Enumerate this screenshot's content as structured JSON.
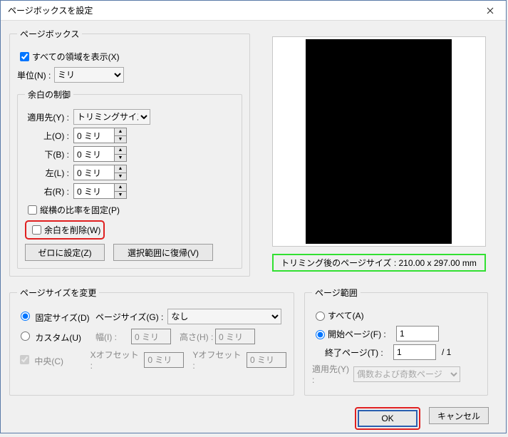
{
  "window": {
    "title": "ページボックスを設定"
  },
  "pageBox": {
    "legend": "ページボックス",
    "showAllAreas": "すべての領域を表示(X)",
    "unitLabel": "単位(N) :",
    "unitValue": "ミリ",
    "margin": {
      "legend": "余白の制御",
      "applyLabel": "適用先(Y) :",
      "applyValue": "トリミングサイズ",
      "topLabel": "上(O) :",
      "topValue": "0 ミリ",
      "bottomLabel": "下(B) :",
      "bottomValue": "0 ミリ",
      "leftLabel": "左(L) :",
      "leftValue": "0 ミリ",
      "rightLabel": "右(R) :",
      "rightValue": "0 ミリ",
      "constrain": "縦横の比率を固定(P)",
      "removeWhite": "余白を削除(W)",
      "zeroBtn": "ゼロに設定(Z)",
      "revertBtn": "選択範囲に復帰(V)"
    }
  },
  "preview": {
    "trimInfo": "トリミング後のページサイズ : 210.00 x 297.00 mm"
  },
  "pageSize": {
    "legend": "ページサイズを変更",
    "fixedLabel": "固定サイズ(D)",
    "customLabel": "カスタム(U)",
    "centerLabel": "中央(C)",
    "pageSizeLabel": "ページサイズ(G) :",
    "pageSizeValue": "なし",
    "widthLabel": "幅(I) :",
    "widthValue": "0 ミリ",
    "heightLabel": "高さ(H) :",
    "heightValue": "0 ミリ",
    "xOffLabel": "Xオフセット :",
    "xOffValue": "0 ミリ",
    "yOffLabel": "Yオフセット :",
    "yOffValue": "0 ミリ"
  },
  "pageRange": {
    "legend": "ページ範囲",
    "allLabel": "すべて(A)",
    "startLabel": "開始ページ(F) :",
    "startValue": "1",
    "endLabel": "終了ページ(T) :",
    "endValue": "1",
    "totalSuffix": "/ 1",
    "applyLabel": "適用先(Y) :",
    "applyValue": "偶数および奇数ページ"
  },
  "actions": {
    "ok": "OK",
    "cancel": "キャンセル"
  }
}
